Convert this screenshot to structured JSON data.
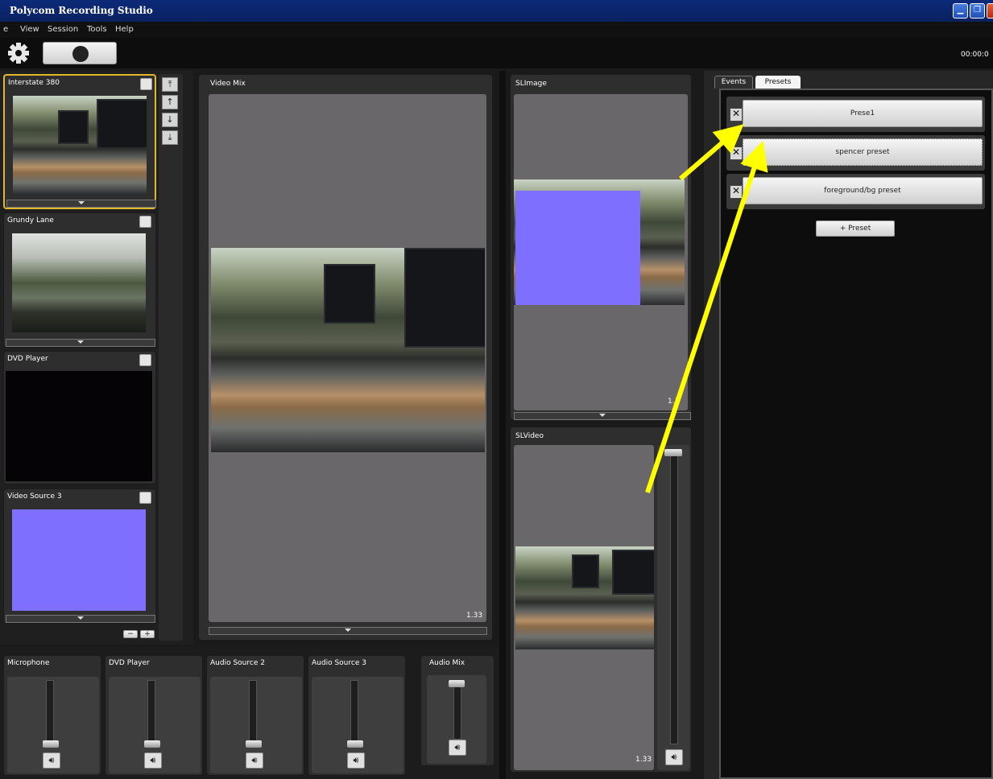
{
  "app": {
    "title": "Polycom Recording Studio"
  },
  "menu": [
    "e",
    "View",
    "Session",
    "Tools",
    "Help"
  ],
  "toolbar": {
    "timer": "00:00:0"
  },
  "sources": [
    {
      "label": "Interstate 380",
      "content": "photo"
    },
    {
      "label": "Grundy Lane",
      "content": "photo"
    },
    {
      "label": "DVD Player",
      "content": "black"
    },
    {
      "label": "Video Source 3",
      "content": "purple"
    }
  ],
  "order_buttons": [
    "⤒",
    "↑",
    "↓",
    "⤓"
  ],
  "list_controls": {
    "remove": "−",
    "add": "+"
  },
  "video_mix": {
    "label": "Video Mix",
    "ratio": "1.33"
  },
  "sl_image": {
    "label": "SLImage",
    "ratio": "1.3"
  },
  "sl_video": {
    "label": "SLVideo",
    "ratio": "1.33"
  },
  "audio": {
    "channels": [
      {
        "label": "Microphone",
        "level": 0.0
      },
      {
        "label": "DVD Player",
        "level": 0.0
      },
      {
        "label": "Audio Source 2",
        "level": 0.0
      },
      {
        "label": "Audio Source 3",
        "level": 0.0
      }
    ],
    "mix": {
      "label": "Audio Mix",
      "level": 1.0
    }
  },
  "tabs": [
    {
      "label": "Events",
      "active": false
    },
    {
      "label": "Presets",
      "active": true
    }
  ],
  "presets": [
    "Prese1",
    "spencer preset",
    "foreground/bg preset"
  ],
  "add_preset_label": "+ Preset",
  "colors": {
    "accent_yellow": "#ffff00",
    "purple": "#7f6fff",
    "titlebar": "#0c2a78"
  }
}
